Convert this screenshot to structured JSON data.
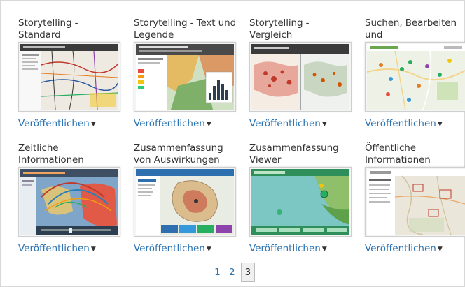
{
  "items": [
    {
      "title": "Storytelling - Standard",
      "publish": "Veröffentlichen"
    },
    {
      "title": "Storytelling - Text und Legende",
      "publish": "Veröffentlichen"
    },
    {
      "title": "Storytelling - Vergleich",
      "publish": "Veröffentlichen"
    },
    {
      "title": "Suchen, Bearbeiten und",
      "publish": "Veröffentlichen"
    },
    {
      "title": "Zeitliche Informationen",
      "publish": "Veröffentlichen"
    },
    {
      "title": "Zusammenfassung von Auswirkungen",
      "publish": "Veröffentlichen"
    },
    {
      "title": "Zusammenfassung Viewer",
      "publish": "Veröffentlichen"
    },
    {
      "title": "Öffentliche Informationen",
      "publish": "Veröffentlichen"
    }
  ],
  "pagination": {
    "pages": [
      "1",
      "2",
      "3"
    ],
    "current": "3"
  },
  "icons": {
    "publish_menu": "caret-down-icon"
  },
  "colors": {
    "link": "#2a73b3",
    "text": "#333333"
  }
}
